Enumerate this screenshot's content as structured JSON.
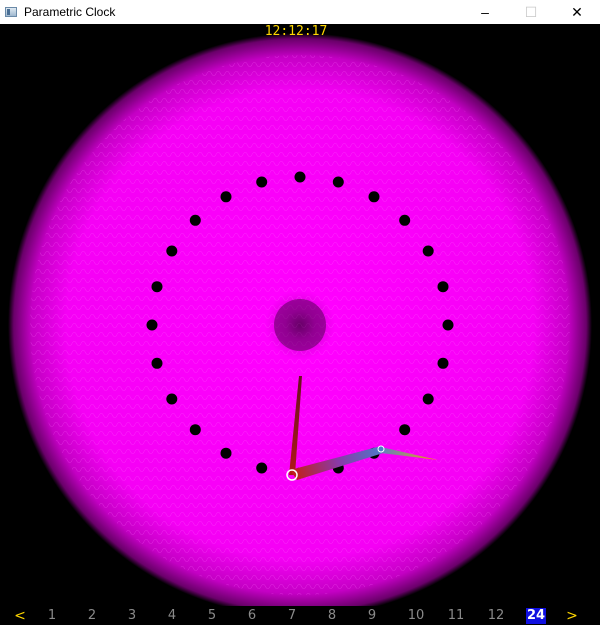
{
  "window": {
    "title": "Parametric Clock",
    "minimize_label": "–",
    "maximize_label": "☐",
    "close_label": "✕"
  },
  "clock": {
    "time": "12:12:17",
    "dot_count": 24,
    "colors": {
      "glow": "#ff00ff",
      "dot": "#000000",
      "time_text": "#ffd700"
    }
  },
  "nav": {
    "prev_label": "<",
    "next_label": ">",
    "pages": [
      "1",
      "2",
      "3",
      "4",
      "5",
      "6",
      "7",
      "8",
      "9",
      "10",
      "11",
      "12",
      "24"
    ],
    "active_page": "24"
  }
}
